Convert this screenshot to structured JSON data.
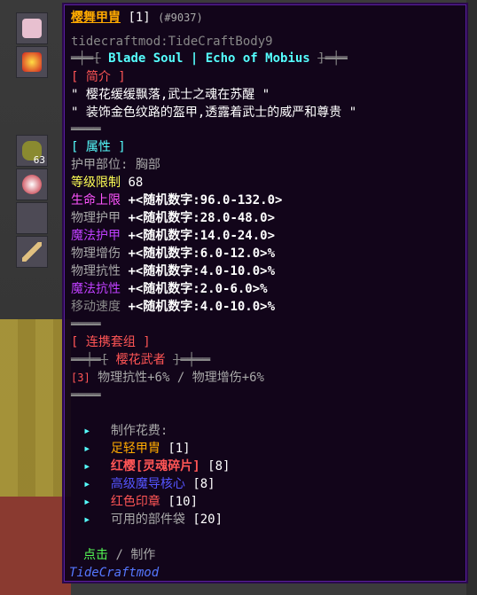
{
  "backdrop": {
    "slot_count_1": "63"
  },
  "tooltip": {
    "name": "樱舞甲胄",
    "amount": "[1]",
    "id": "(#9037)",
    "registry": "tidecraftmod:TideCraftBody9",
    "series_deco_left": "═╪═[",
    "series_name": "Blade Soul | Echo of Mobius",
    "series_deco_right": "]═╪═",
    "intro_header": "[ 简介 ]",
    "intro_line1": "\" 樱花缓缓飘落,武士之魂在苏醒 \"",
    "intro_line2": "\" 装饰金色纹路的盔甲,透露着武士的威严和尊贵 \"",
    "sep": "════",
    "attr_header": "[ 属性 ]",
    "slot_label": "护甲部位:",
    "slot_value": "胸部",
    "level_label": "等级限制",
    "level_value": "68",
    "stats": [
      {
        "name": "生命上限",
        "value": "+<随机数字:96.0-132.0>"
      },
      {
        "name": "物理护甲",
        "value": "+<随机数字:28.0-48.0>"
      },
      {
        "name": "魔法护甲",
        "value": "+<随机数字:14.0-24.0>"
      },
      {
        "name": "物理增伤",
        "value": "+<随机数字:6.0-12.0>%"
      },
      {
        "name": "物理抗性",
        "value": "+<随机数字:4.0-10.0>%"
      },
      {
        "name": "魔法抗性",
        "value": "+<随机数字:2.0-6.0>%"
      },
      {
        "name": "移动速度",
        "value": "+<随机数字:4.0-10.0>%"
      }
    ],
    "set_header": "[ 连携套组 ]",
    "set_deco_left": "══╪═[",
    "set_name": "樱花武者",
    "set_deco_right": "]═╪══",
    "set_bonus_count": "[3]",
    "set_bonus_text": "物理抗性+6% / 物理增伤+6%",
    "craft_header": "制作花费:",
    "craft_items": [
      {
        "name": "足轻甲胄",
        "count": "[1]"
      },
      {
        "name": "红樱[灵魂碎片]",
        "count": "[8]"
      },
      {
        "name": "高级魔导核心",
        "count": "[8]"
      },
      {
        "name": "红色印章",
        "count": "[10]"
      },
      {
        "name": "可用的部件袋",
        "count": "[20]"
      }
    ],
    "action_click": "点击",
    "action_sep": "/",
    "action_craft": "制作",
    "mod_name": "TideCraftmod"
  }
}
